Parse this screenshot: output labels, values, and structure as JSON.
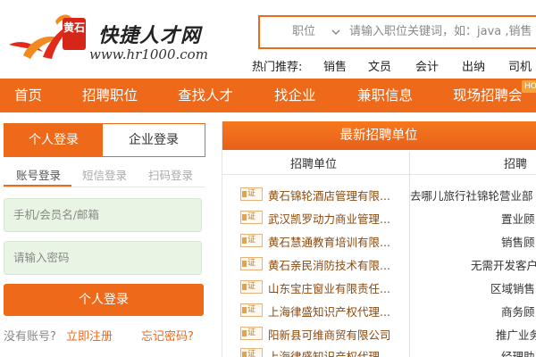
{
  "brand": {
    "logo_mark": "黄石",
    "name": "快捷人才网",
    "url": "www.hr1000.com",
    "accent": "#ee6a1a"
  },
  "search": {
    "category": "职位",
    "placeholder": "请输入职位关键词，如：java ,销售"
  },
  "hot": {
    "label": "热门推荐:",
    "items": [
      "销售",
      "文员",
      "会计",
      "出纳",
      "司机"
    ]
  },
  "nav": {
    "items": [
      "首页",
      "招聘职位",
      "查找人才",
      "找企业",
      "兼职信息",
      "现场招聘会"
    ],
    "hot_tag": "HOT"
  },
  "login": {
    "tab_personal": "个人登录",
    "tab_company": "企业登录",
    "subtabs": [
      "账号登录",
      "短信登录",
      "扫码登录"
    ],
    "username_placeholder": "手机/会员名/邮箱",
    "password_placeholder": "请输入密码",
    "button": "个人登录",
    "no_account": "没有账号?",
    "register": "立即注册",
    "forgot": "忘记密码?"
  },
  "companies": {
    "title": "最新招聘单位",
    "col_company": "招聘单位",
    "col_job": "招聘",
    "badge": "证",
    "rows": [
      {
        "company": "黄石锦轮酒店管理有限...",
        "job": "去哪儿旅行社锦轮营业部"
      },
      {
        "company": "武汉凯罗动力商业管理...",
        "job": "置业顾"
      },
      {
        "company": "黄石慧通教育培训有限...",
        "job": "销售顾"
      },
      {
        "company": "黄石亲民消防技术有限...",
        "job": "无需开发客户"
      },
      {
        "company": "山东宝庄窗业有限责任...",
        "job": "区域销售"
      },
      {
        "company": "上海律盛知识产权代理...",
        "job": "商务顾"
      },
      {
        "company": "阳新县可维商贸有限公司",
        "job": "推广业务"
      },
      {
        "company": "上海律盛知识产权代理...",
        "job": "经理助"
      }
    ]
  }
}
